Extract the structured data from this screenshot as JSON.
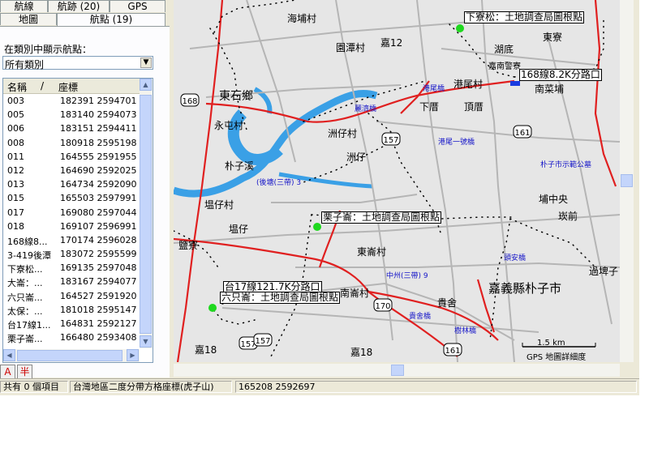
{
  "tabs_row1": [
    "航線",
    "航跡 (20)",
    "GPS"
  ],
  "tabs_row2": [
    "地圖",
    "航點 (19)"
  ],
  "waypoint_panel": {
    "category_label": "在類別中顯示航點：",
    "category_value": "所有類別",
    "columns": {
      "name": "名稱",
      "sort": "/",
      "coord": "座標"
    },
    "rows": [
      {
        "name": "003",
        "coord": "182391 2594701"
      },
      {
        "name": "005",
        "coord": "183140 2594073"
      },
      {
        "name": "006",
        "coord": "183151 2594411"
      },
      {
        "name": "008",
        "coord": "180918 2595198"
      },
      {
        "name": "011",
        "coord": "164555 2591955"
      },
      {
        "name": "012",
        "coord": "164690 2592025"
      },
      {
        "name": "013",
        "coord": "164734 2592090"
      },
      {
        "name": "015",
        "coord": "165503 2597991"
      },
      {
        "name": "017",
        "coord": "169080 2597044"
      },
      {
        "name": "018",
        "coord": "169107 2596991"
      },
      {
        "name": "168線8...",
        "coord": "170174 2596028"
      },
      {
        "name": "3-419後潭",
        "coord": "183072 2595599"
      },
      {
        "name": "下寮松...",
        "coord": "169135 2597048"
      },
      {
        "name": "大崙：...",
        "coord": "183167 2594077"
      },
      {
        "name": "六只崙...",
        "coord": "164527 2591920"
      },
      {
        "name": "太保：...",
        "coord": "181018 2595147"
      },
      {
        "name": "台17線1...",
        "coord": "164831 2592127"
      },
      {
        "name": "栗子崙...",
        "coord": "166480 2593408"
      }
    ]
  },
  "map": {
    "places": [
      {
        "id": "haipu",
        "text": "海埔村"
      },
      {
        "id": "yuantan",
        "text": "園潭村"
      },
      {
        "id": "jia12",
        "text": "嘉12"
      },
      {
        "id": "hudi",
        "text": "湖底"
      },
      {
        "id": "dongliao",
        "text": "東寮"
      },
      {
        "id": "jiananlu",
        "text": "嘉南警寮"
      },
      {
        "id": "gangwei",
        "text": "港尾村"
      },
      {
        "id": "nanyezhai",
        "text": "南菜埔"
      },
      {
        "id": "dongshi",
        "text": "東石鄉"
      },
      {
        "id": "yongtun",
        "text": "永屯村"
      },
      {
        "id": "zhouzi",
        "text": "洲仔村"
      },
      {
        "id": "xiacuo",
        "text": "下厝"
      },
      {
        "id": "dingcuo",
        "text": "頂厝"
      },
      {
        "id": "zhouzai2",
        "text": "洲仔"
      },
      {
        "id": "puzixi",
        "text": "朴子溪"
      },
      {
        "id": "taizai",
        "text": "塭仔村"
      },
      {
        "id": "puzhongyang",
        "text": "埔中央"
      },
      {
        "id": "tanqian",
        "text": "崁前"
      },
      {
        "id": "taizai2",
        "text": "塭仔"
      },
      {
        "id": "dongcuo",
        "text": "東崙村"
      },
      {
        "id": "yanfu",
        "text": "鹽寮"
      },
      {
        "id": "guopi",
        "text": "過埤子"
      },
      {
        "id": "jiayi",
        "text": "嘉義縣朴子市"
      },
      {
        "id": "nancuo",
        "text": "南崙村"
      },
      {
        "id": "guishe",
        "text": "貴舍"
      },
      {
        "id": "jia18a",
        "text": "嘉18"
      },
      {
        "id": "jia18b",
        "text": "嘉18"
      }
    ],
    "small_labels": [
      {
        "id": "gangweiqiao",
        "text": "港尾橋"
      },
      {
        "id": "zhouqiao",
        "text": "麗濟橋"
      },
      {
        "id": "gangwei1",
        "text": "港尾一號橋"
      },
      {
        "id": "puzigong",
        "text": "朴子市示範公墓"
      },
      {
        "id": "houtan",
        "text": "(後塘(三帶) 3"
      },
      {
        "id": "zhonggang",
        "text": "中州(三帶) 9"
      },
      {
        "id": "qingan",
        "text": "頭安橋"
      },
      {
        "id": "guiqiao",
        "text": "貴舍橋"
      },
      {
        "id": "shulin",
        "text": "樹林橋"
      }
    ],
    "waypoint_labels": [
      {
        "id": "wp1",
        "text": "下寮松：土地調查局圖根點"
      },
      {
        "id": "wp2",
        "text": "168線8.2K分路口"
      },
      {
        "id": "wp3",
        "text": "栗子崙：土地調查局圖根點"
      },
      {
        "id": "wp4",
        "text": "台17線121.7K分路口"
      },
      {
        "id": "wp5",
        "text": "六只崙：土地調查局圖根點"
      }
    ],
    "road_shields": [
      "157",
      "168",
      "161",
      "157",
      "170",
      "161",
      "157"
    ],
    "scale_text": "1.5 km",
    "detail_text": "GPS 地圖詳細度"
  },
  "status": {
    "items_count": "共有 0 個項目",
    "grid": "台灣地區二度分帶方格座標(虎子山)",
    "coords": "165208 2592697"
  },
  "ime": [
    "A",
    "半"
  ]
}
